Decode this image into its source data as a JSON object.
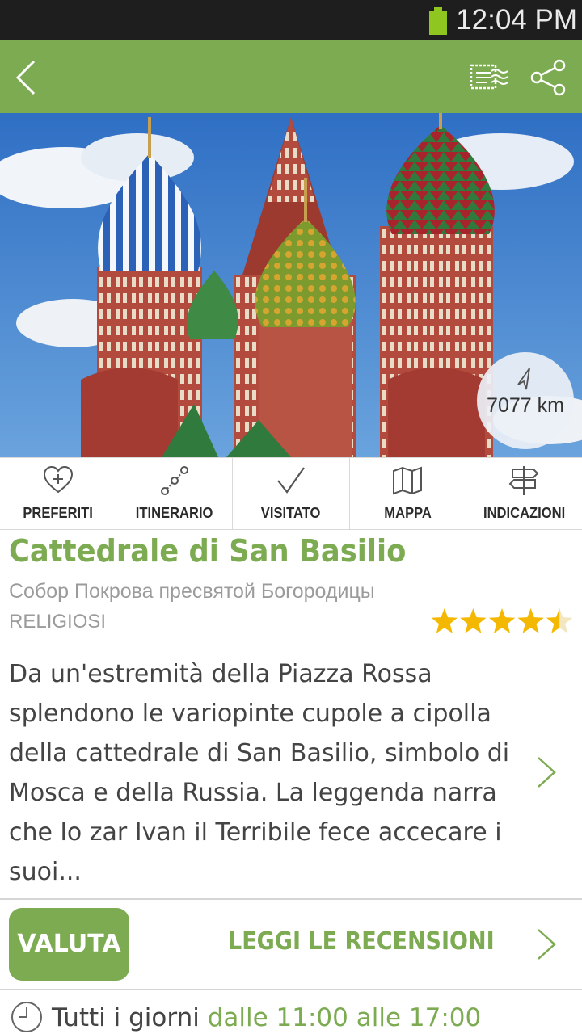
{
  "status_bar": {
    "time": "12:04 PM"
  },
  "place": {
    "name": "Cattedrale di San Basilio",
    "native_name": "Собор Покрова пресвятой Богородицы",
    "category": "RELIGIOSI",
    "rating": 4.5,
    "rating_max": 5,
    "distance": "7077 km",
    "description": "Da un'estremità della Piazza Rossa splendono le variopinte cupole a cipolla della cattedrale di San Basilio, simbolo di Mosca e della Russia. La leggenda narra che lo zar Ivan il Terribile fece accecare i suoi..."
  },
  "actions": [
    {
      "label": "PREFERITI",
      "icon": "heart-plus-icon"
    },
    {
      "label": "ITINERARIO",
      "icon": "route-icon"
    },
    {
      "label": "VISITATO",
      "icon": "checkmark-icon"
    },
    {
      "label": "MAPPA",
      "icon": "map-icon"
    },
    {
      "label": "INDICAZIONI",
      "icon": "signpost-icon"
    }
  ],
  "buttons": {
    "rate": "VALUTA",
    "reviews": "LEGGI LE RECENSIONI"
  },
  "hours": {
    "days": "Tutti i giorni",
    "time": "dalle 11:00 alle 17:00"
  },
  "colors": {
    "accent": "#7dab52",
    "status_bar": "#1e1e1e",
    "star": "#f5b800"
  }
}
